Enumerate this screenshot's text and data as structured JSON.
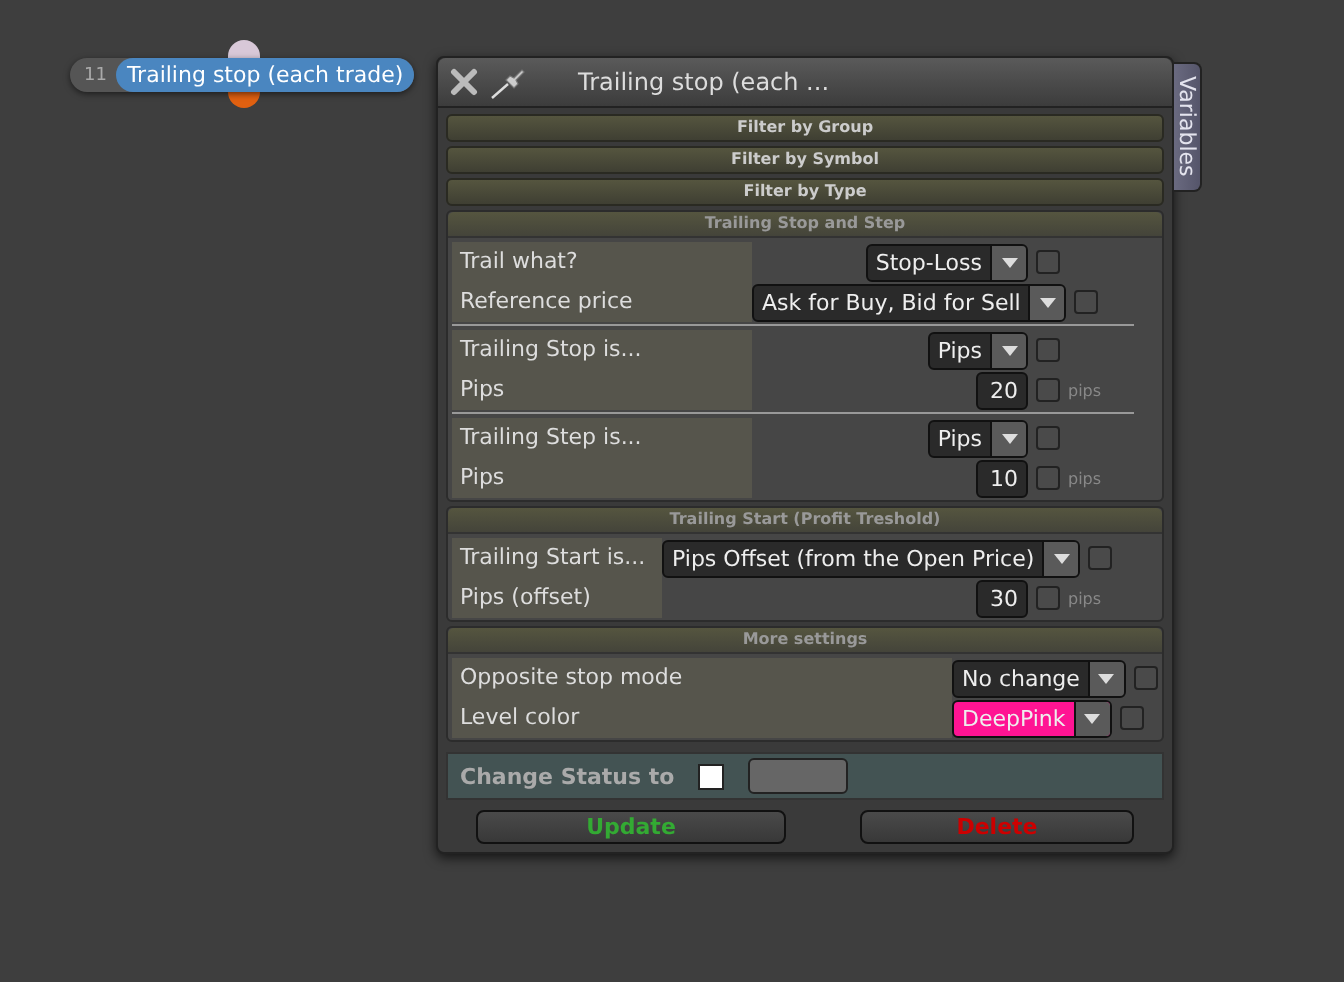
{
  "node": {
    "number": "11",
    "label": "Trailing stop (each trade)"
  },
  "window": {
    "title": "Trailing stop (each ...",
    "side_tab": "Variables"
  },
  "filters": [
    "Filter by Group",
    "Filter by Symbol",
    "Filter by Type"
  ],
  "sections": [
    {
      "title": "Trailing Stop and Step",
      "groups": [
        [
          {
            "label": "Trail what?",
            "kind": "dropdown",
            "value": "Stop-Loss",
            "checked": false
          },
          {
            "label": "Reference price",
            "kind": "dropdown",
            "value": "Ask for Buy, Bid for Sell",
            "checked": false
          }
        ],
        [
          {
            "label": "Trailing Stop is...",
            "kind": "dropdown",
            "value": "Pips",
            "checked": false
          },
          {
            "label": "Pips",
            "kind": "number",
            "value": "20",
            "checked": false,
            "unit": "pips"
          }
        ],
        [
          {
            "label": "Trailing Step is...",
            "kind": "dropdown",
            "value": "Pips",
            "checked": false
          },
          {
            "label": "Pips",
            "kind": "number",
            "value": "10",
            "checked": false,
            "unit": "pips"
          }
        ]
      ]
    },
    {
      "title": "Trailing Start (Profit Treshold)",
      "groups": [
        [
          {
            "label": "Trailing Start is...",
            "kind": "dropdown",
            "value": "Pips Offset (from the Open Price)",
            "checked": false
          },
          {
            "label": "Pips (offset)",
            "kind": "number",
            "value": "30",
            "checked": false,
            "unit": "pips"
          }
        ]
      ]
    },
    {
      "title": "More settings",
      "groups": [
        [
          {
            "label": "Opposite stop mode",
            "kind": "dropdown",
            "value": "No change",
            "checked": false
          },
          {
            "label": "Level color",
            "kind": "dropdown",
            "value": "DeepPink",
            "checked": false,
            "color": "#ff1493"
          }
        ]
      ]
    }
  ],
  "status": {
    "label": "Change Status to",
    "checked": false
  },
  "buttons": [
    {
      "label": "Update",
      "kind": "update"
    },
    {
      "label": "Delete",
      "kind": "delete"
    }
  ]
}
